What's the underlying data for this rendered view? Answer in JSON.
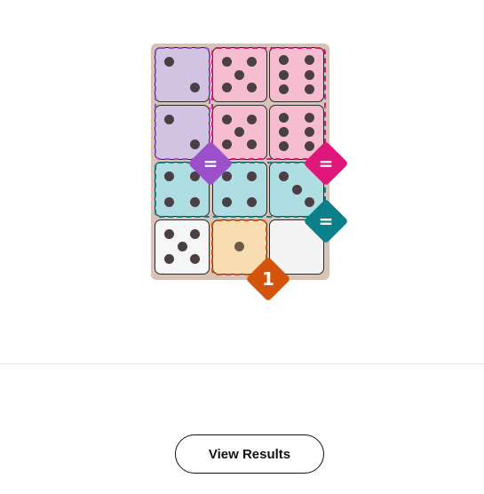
{
  "game": {
    "board_cells": [
      {
        "row": 0,
        "col": 0,
        "pips": 2,
        "color": "#d2c3e2"
      },
      {
        "row": 0,
        "col": 1,
        "pips": 5,
        "color": "#f6bccf"
      },
      {
        "row": 0,
        "col": 2,
        "pips": 6,
        "color": "#f6bccf"
      },
      {
        "row": 1,
        "col": 0,
        "pips": 2,
        "color": "#d2c3e2"
      },
      {
        "row": 1,
        "col": 1,
        "pips": 5,
        "color": "#f6bccf"
      },
      {
        "row": 1,
        "col": 2,
        "pips": 6,
        "color": "#f6bccf"
      },
      {
        "row": 2,
        "col": 0,
        "pips": 4,
        "color": "#aedde2"
      },
      {
        "row": 2,
        "col": 1,
        "pips": 4,
        "color": "#aedde2"
      },
      {
        "row": 2,
        "col": 2,
        "pips": 3,
        "color": "#aedde2"
      },
      {
        "row": 3,
        "col": 0,
        "pips": 5,
        "color": "#f6f6f6"
      },
      {
        "row": 3,
        "col": 1,
        "pips": 1,
        "color": "#f8dcb2"
      },
      {
        "row": 3,
        "col": 2,
        "pips": 0,
        "color": "#f4f4f4"
      }
    ],
    "constraints": [
      {
        "label": "=",
        "color": "#9b4fc9",
        "region": "purple"
      },
      {
        "label": "=",
        "color": "#e0177a",
        "region": "pink"
      },
      {
        "label": "=",
        "color": "#0c7f8b",
        "region": "teal"
      },
      {
        "label": "1",
        "color": "#d4540c",
        "region": "orange"
      }
    ]
  },
  "footer": {
    "view_results_label": "View Results"
  }
}
